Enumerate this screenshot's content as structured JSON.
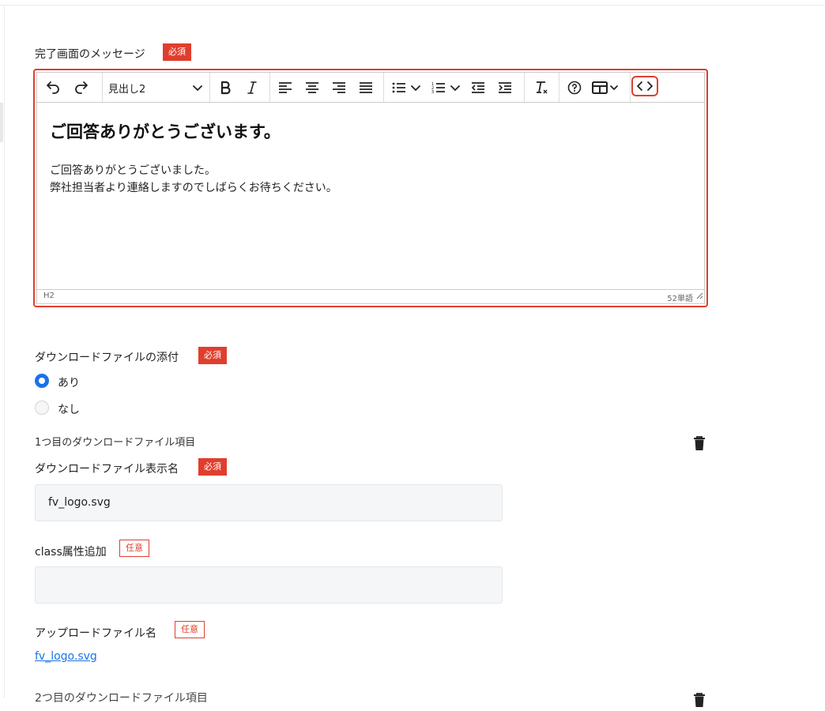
{
  "message_section": {
    "label": "完了画面のメッセージ",
    "required_badge": "必須"
  },
  "editor": {
    "toolbar": {
      "block_format": "見出し2",
      "buttons": [
        "undo-icon",
        "redo-icon",
        "bold-icon",
        "italic-icon",
        "align-left-icon",
        "align-center-icon",
        "align-right-icon",
        "align-justify-icon",
        "bullet-list-icon",
        "numbered-list-icon",
        "outdent-icon",
        "indent-icon",
        "clear-format-icon",
        "help-icon",
        "table-icon",
        "source-code-icon"
      ]
    },
    "heading": "ご回答ありがとうございます。",
    "paragraph_line1": "ご回答ありがとうございました。",
    "paragraph_line2": "弊社担当者より連絡しますのでしばらくお待ちください。",
    "status_path": "H2",
    "word_count": "52単語"
  },
  "attachment": {
    "label": "ダウンロードファイルの添付",
    "required_badge": "必須",
    "options": [
      {
        "label": "あり",
        "selected": true
      },
      {
        "label": "なし",
        "selected": false
      }
    ]
  },
  "file_item_1": {
    "title": "1つ目のダウンロードファイル項目",
    "display_name_label": "ダウンロードファイル表示名",
    "display_name_badge": "必須",
    "display_name_value": "fv_logo.svg",
    "class_label": "class属性追加",
    "class_badge": "任意",
    "class_value": "",
    "upload_label": "アップロードファイル名",
    "upload_badge": "任意",
    "upload_link": "fv_logo.svg"
  },
  "file_item_2": {
    "title": "2つ目のダウンロードファイル項目"
  },
  "colors": {
    "required_red": "#e03e2d",
    "accent_blue": "#1a73e8"
  }
}
